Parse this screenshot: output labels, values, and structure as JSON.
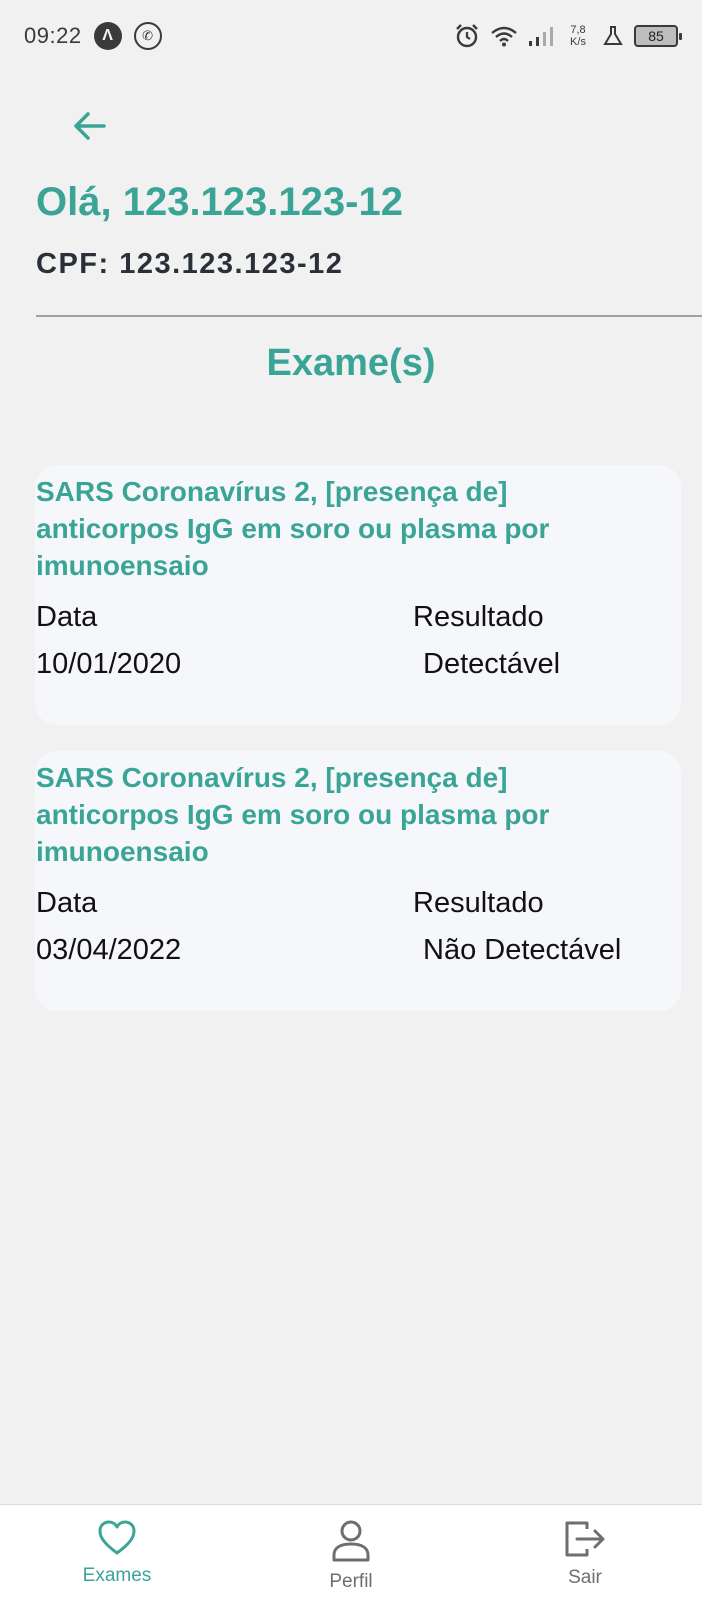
{
  "status_bar": {
    "time": "09:22",
    "net_speed_value": "7,8",
    "net_speed_unit": "K/s",
    "battery": "85",
    "icons": [
      "notification-a-icon",
      "whatsapp-icon",
      "alarm-icon",
      "wifi-icon",
      "signal-icon",
      "flask-icon",
      "battery-icon"
    ]
  },
  "header": {
    "greeting": "Olá, 123.123.123-12",
    "cpf": "CPF: 123.123.123-12"
  },
  "section_title": "Exame(s)",
  "exams": [
    {
      "title": "SARS Coronavírus 2, [presença de] anticorpos IgG em soro ou plasma por imunoensaio",
      "date_label": "Data",
      "date": "10/01/2020",
      "result_label": "Resultado",
      "result": "Detectável"
    },
    {
      "title": "SARS Coronavírus 2, [presença de] anticorpos IgG em soro ou plasma por imunoensaio",
      "date_label": "Data",
      "date": "03/04/2022",
      "result_label": "Resultado",
      "result": "Não Detectável"
    }
  ],
  "nav": {
    "items": [
      {
        "label": "Exames",
        "icon": "heart-icon",
        "active": true
      },
      {
        "label": "Perfil",
        "icon": "person-icon",
        "active": false
      },
      {
        "label": "Sair",
        "icon": "logout-icon",
        "active": false
      }
    ]
  },
  "colors": {
    "accent": "#3aa597",
    "background": "#f1f1f1",
    "card": "#f6f7fb",
    "inactive": "#6e6e6e"
  }
}
